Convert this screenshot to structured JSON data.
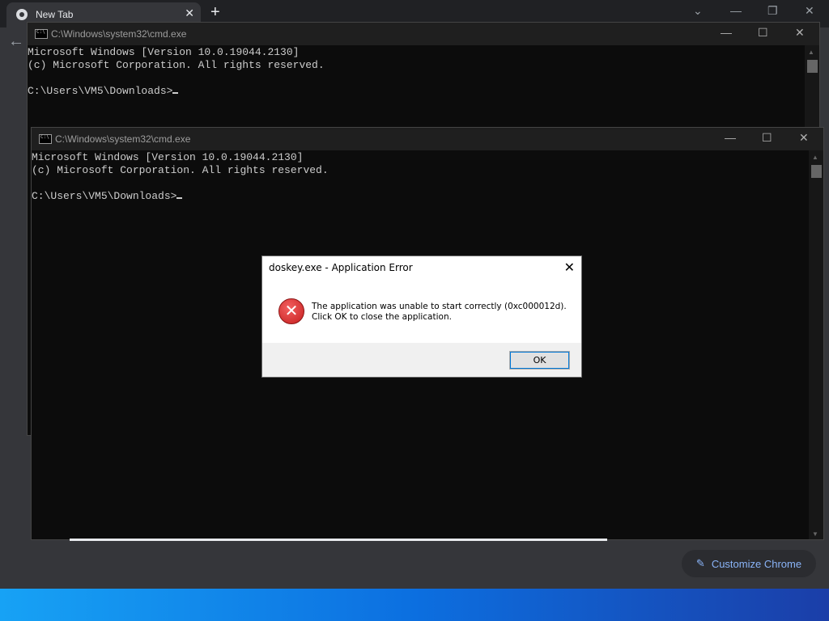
{
  "browser": {
    "tab_title": "New Tab",
    "customize_label": "Customize Chrome"
  },
  "cmd_back": {
    "title": "C:\\Windows\\system32\\cmd.exe",
    "lines": [
      "Microsoft Windows [Version 10.0.19044.2130]",
      "(c) Microsoft Corporation. All rights reserved.",
      "",
      "C:\\Users\\VM5\\Downloads>"
    ]
  },
  "cmd_front": {
    "title": "C:\\Windows\\system32\\cmd.exe",
    "lines": [
      "Microsoft Windows [Version 10.0.19044.2130]",
      "(c) Microsoft Corporation. All rights reserved.",
      "",
      "C:\\Users\\VM5\\Downloads>"
    ]
  },
  "dialog": {
    "title": "doskey.exe - Application Error",
    "message_line1": "The application was unable to start correctly (0xc000012d).",
    "message_line2": "Click OK to close the application.",
    "ok_label": "OK",
    "icon": "error-icon"
  },
  "colors": {
    "taskbar": "#0c6fe0",
    "console_bg": "#0c0c0c",
    "console_text": "#cccccc",
    "accent": "#8ab4f8"
  }
}
